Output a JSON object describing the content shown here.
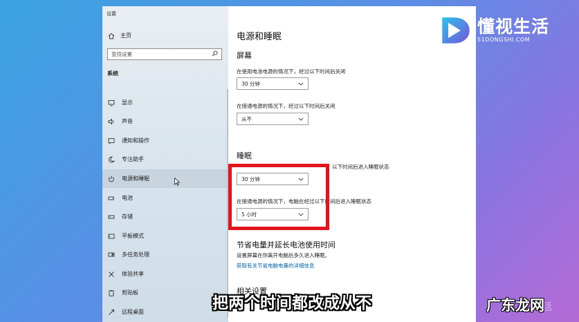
{
  "window": {
    "title": "设置"
  },
  "sidebar": {
    "home_label": "主页",
    "search_placeholder": "查找设置",
    "section_label": "系统",
    "items": [
      {
        "label": "显示",
        "icon": "monitor-icon"
      },
      {
        "label": "声音",
        "icon": "speaker-icon"
      },
      {
        "label": "通知和操作",
        "icon": "notification-icon"
      },
      {
        "label": "专注助手",
        "icon": "moon-icon"
      },
      {
        "label": "电源和睡眠",
        "icon": "power-icon",
        "selected": true
      },
      {
        "label": "电池",
        "icon": "battery-icon"
      },
      {
        "label": "存储",
        "icon": "storage-icon"
      },
      {
        "label": "平板模式",
        "icon": "tablet-icon"
      },
      {
        "label": "多任务处理",
        "icon": "multitask-icon"
      },
      {
        "label": "体验共享",
        "icon": "share-icon"
      },
      {
        "label": "剪贴板",
        "icon": "clipboard-icon"
      },
      {
        "label": "远程桌面",
        "icon": "remote-desktop-icon"
      }
    ]
  },
  "main": {
    "title": "电源和睡眠",
    "screen": {
      "heading": "屏幕",
      "battery_desc": "在使用电池电源的情况下，经过以下时间后关闭",
      "battery_value": "30 分钟",
      "plugged_desc": "在接通电源的情况下，经过以下时间后关闭",
      "plugged_value": "从不"
    },
    "sleep": {
      "heading": "睡眠",
      "battery_desc_visible": "以下时间后进入睡眠状态",
      "battery_value": "30 分钟",
      "plugged_desc": "在接通电源的情况下，电脑在经过以下时间后进入睡眠状态",
      "plugged_value": "5 小时"
    },
    "battery_saving": {
      "heading": "节省电量并延长电池使用时间",
      "desc": "设置屏幕在你离开电脑后多久进入睡眠。",
      "link": "获取有关节省电脑电量的详细信息"
    },
    "related": {
      "heading": "相关设置"
    }
  },
  "overlay": {
    "logo_main": "懂视生活",
    "logo_sub": "51DONGSHI.COM",
    "subtitle": "把两个时间都改成从不",
    "watermark": "广东龙网",
    "watermark_faint": "生活"
  },
  "colors": {
    "highlight": "#e4141c",
    "link": "#0063b1"
  }
}
